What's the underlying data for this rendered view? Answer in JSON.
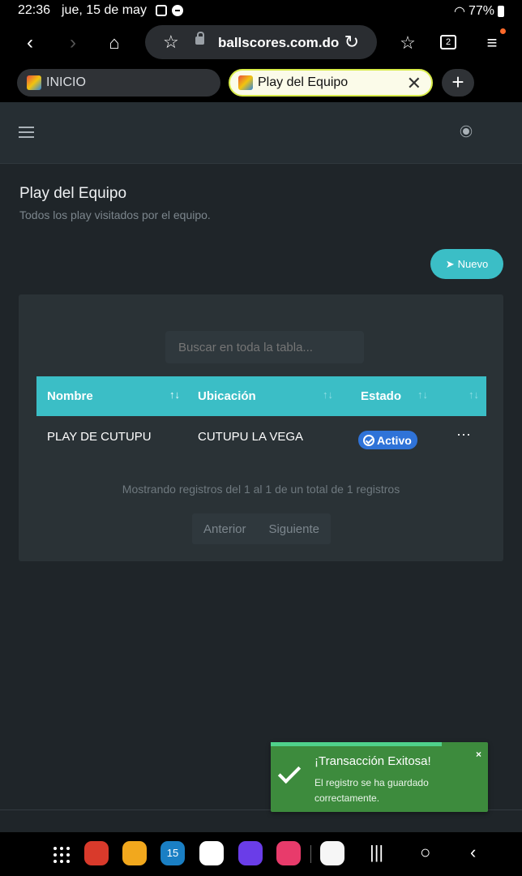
{
  "status": {
    "time": "22:36",
    "date": "jue, 15 de may",
    "battery": "77%"
  },
  "browser": {
    "url": "ballscores.com.do",
    "tab_count": "2",
    "tabs": [
      {
        "label": "INICIO",
        "active": false
      },
      {
        "label": "Play del Equipo",
        "active": true
      }
    ]
  },
  "page": {
    "title": "Play del Equipo",
    "subtitle": "Todos los play visitados por el equipo.",
    "new_button": "Nuevo",
    "search_placeholder": "Buscar en toda la tabla...",
    "columns": [
      "Nombre",
      "Ubicación",
      "Estado"
    ],
    "rows": [
      {
        "nombre": "PLAY DE CUTUPU",
        "ubicacion": "CUTUPU LA VEGA",
        "estado": "Activo"
      }
    ],
    "info": "Mostrando registros del 1 al 1 de un total de 1 registros",
    "pager": {
      "prev": "Anterior",
      "next": "Siguiente"
    }
  },
  "toast": {
    "title": "¡Transacción Exitosa!",
    "message": "El registro se ha guardado correctamente.",
    "close": "×",
    "color": "#3d8b3d"
  },
  "colors": {
    "accent": "#3bbec6",
    "badge": "#2f73d8",
    "background": "#1f2529"
  },
  "calendar_day": "15"
}
